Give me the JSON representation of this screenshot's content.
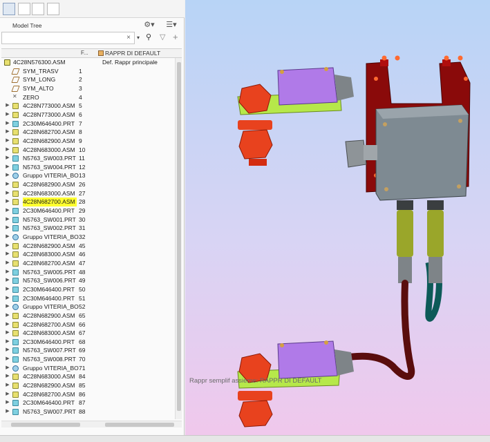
{
  "panel": {
    "title": "Model Tree",
    "tabs": [
      "model-tree-icon",
      "layers-icon",
      "folder-browser-icon",
      "favorites-icon"
    ],
    "search_clear": "×",
    "settings_icon": "tree-settings-icon",
    "columns_icon": "tree-columns-icon"
  },
  "tree": {
    "columns": {
      "f_header": "F...",
      "rappr_header": "RAPPR DI DEFAULT"
    },
    "rows": [
      {
        "label": "4C28N576300.ASM",
        "num": "",
        "type": "root",
        "expand": "",
        "rappr": "Def. Rappr principale"
      },
      {
        "label": "SYM_TRASV",
        "num": "1",
        "type": "plane",
        "expand": ""
      },
      {
        "label": "SYM_LONG",
        "num": "2",
        "type": "plane",
        "expand": ""
      },
      {
        "label": "SYM_ALTO",
        "num": "3",
        "type": "plane",
        "expand": ""
      },
      {
        "label": "ZERO",
        "num": "4",
        "type": "csys",
        "expand": ""
      },
      {
        "label": "4C28N773000.ASM",
        "num": "5",
        "type": "asm",
        "expand": "▶"
      },
      {
        "label": "4C28N773000.ASM",
        "num": "6",
        "type": "asm",
        "expand": "▶"
      },
      {
        "label": "2C30M646400.PRT",
        "num": "7",
        "type": "prt",
        "expand": "▶"
      },
      {
        "label": "4C28N682700.ASM",
        "num": "8",
        "type": "asm",
        "expand": "▶"
      },
      {
        "label": "4C28N682900.ASM",
        "num": "9",
        "type": "asm",
        "expand": "▶"
      },
      {
        "label": "4C28N683000.ASM",
        "num": "10",
        "type": "asm",
        "expand": "▶"
      },
      {
        "label": "N5763_SW003.PRT",
        "num": "11",
        "type": "prt",
        "expand": "▶"
      },
      {
        "label": "N5763_SW004.PRT",
        "num": "12",
        "type": "prt",
        "expand": "▶"
      },
      {
        "label": "Gruppo VITERIA_BO",
        "num": "13",
        "type": "group",
        "expand": "▶"
      },
      {
        "label": "4C28N682900.ASM",
        "num": "26",
        "type": "asm",
        "expand": "▶"
      },
      {
        "label": "4C28N683000.ASM",
        "num": "27",
        "type": "asm",
        "expand": "▶"
      },
      {
        "label": "4C28N682700.ASM",
        "num": "28",
        "type": "asm",
        "expand": "▶",
        "highlight": true
      },
      {
        "label": "2C30M646400.PRT",
        "num": "29",
        "type": "prt",
        "expand": "▶"
      },
      {
        "label": "N5763_SW001.PRT",
        "num": "30",
        "type": "prt",
        "expand": "▶"
      },
      {
        "label": "N5763_SW002.PRT",
        "num": "31",
        "type": "prt",
        "expand": "▶"
      },
      {
        "label": "Gruppo VITERIA_BO",
        "num": "32",
        "type": "group",
        "expand": "▶"
      },
      {
        "label": "4C28N682900.ASM",
        "num": "45",
        "type": "asm",
        "expand": "▶"
      },
      {
        "label": "4C28N683000.ASM",
        "num": "46",
        "type": "asm",
        "expand": "▶"
      },
      {
        "label": "4C28N682700.ASM",
        "num": "47",
        "type": "asm",
        "expand": "▶"
      },
      {
        "label": "N5763_SW005.PRT",
        "num": "48",
        "type": "prt",
        "expand": "▶"
      },
      {
        "label": "N5763_SW006.PRT",
        "num": "49",
        "type": "prt",
        "expand": "▶"
      },
      {
        "label": "2C30M646400.PRT",
        "num": "50",
        "type": "prt",
        "expand": "▶"
      },
      {
        "label": "2C30M646400.PRT",
        "num": "51",
        "type": "prt",
        "expand": "▶"
      },
      {
        "label": "Gruppo VITERIA_BO",
        "num": "52",
        "type": "group",
        "expand": "▶"
      },
      {
        "label": "4C28N682900.ASM",
        "num": "65",
        "type": "asm",
        "expand": "▶"
      },
      {
        "label": "4C28N682700.ASM",
        "num": "66",
        "type": "asm",
        "expand": "▶"
      },
      {
        "label": "4C28N683000.ASM",
        "num": "67",
        "type": "asm",
        "expand": "▶"
      },
      {
        "label": "2C30M646400.PRT",
        "num": "68",
        "type": "prt",
        "expand": "▶"
      },
      {
        "label": "N5763_SW007.PRT",
        "num": "69",
        "type": "prt",
        "expand": "▶"
      },
      {
        "label": "N5763_SW008.PRT",
        "num": "70",
        "type": "prt",
        "expand": "▶"
      },
      {
        "label": "Gruppo VITERIA_BO",
        "num": "71",
        "type": "group",
        "expand": "▶"
      },
      {
        "label": "4C28N683000.ASM",
        "num": "84",
        "type": "asm",
        "expand": "▶"
      },
      {
        "label": "4C28N682900.ASM",
        "num": "85",
        "type": "asm",
        "expand": "▶"
      },
      {
        "label": "4C28N682700.ASM",
        "num": "86",
        "type": "asm",
        "expand": "▶"
      },
      {
        "label": "2C30M646400.PRT",
        "num": "87",
        "type": "prt",
        "expand": "▶"
      },
      {
        "label": "N5763_SW007.PRT",
        "num": "88",
        "type": "prt",
        "expand": "▶"
      }
    ]
  },
  "viewport": {
    "note": "Rappr semplif assieme: RAPPR DI DEFAULT",
    "background_top": "#b8d4f6",
    "background_bottom": "#f0c8ec",
    "colors": {
      "bracket": "#8a0a0a",
      "box": "#7e8a92",
      "sensor": "#b07ae8",
      "plate": "#b6e84a",
      "nut": "#e8421e",
      "connector": "#9aa62a",
      "cable": "#5a0d0d",
      "cable_teal": "#0d5a58"
    }
  }
}
